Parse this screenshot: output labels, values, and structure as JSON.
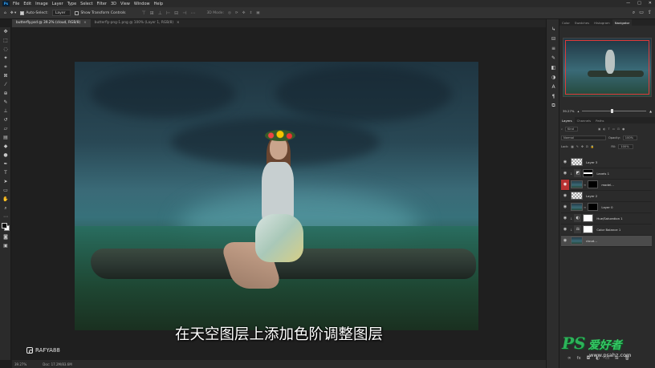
{
  "app": {
    "logo": "Ps"
  },
  "menu": [
    "File",
    "Edit",
    "Image",
    "Layer",
    "Type",
    "Select",
    "Filter",
    "3D",
    "View",
    "Window",
    "Help"
  ],
  "window_controls": [
    "—",
    "□",
    "✕"
  ],
  "options": {
    "auto_select_label": "Auto-Select:",
    "auto_select_target": "Layer",
    "show_transform_label": "Show Transform Controls",
    "mode_3d_label": "3D Mode:"
  },
  "tabs": [
    {
      "label": "butterfly.psd @ 39.2% (cloud, RGB/8)",
      "close": "×"
    },
    {
      "label": "butterfly-png-1.png @ 100% (Layer 1, RGB/8)",
      "close": "×"
    }
  ],
  "subtitle": "在天空图层上添加色阶调整图层",
  "watermark": {
    "handle": "RAFYA88"
  },
  "status": {
    "zoom": "39.27%",
    "doc": "Doc: 17.2M/83.6M"
  },
  "right_panel": {
    "top_tabs": [
      "Color",
      "Swatches",
      "Histogram",
      "Navigator"
    ],
    "active_top_tab": "Navigator",
    "nav_zoom": "39.27%",
    "layer_tabs": [
      "Layers",
      "Channels",
      "Paths"
    ],
    "kind_label": "Kind",
    "blend_mode": "Normal",
    "opacity_label": "Opacity:",
    "opacity_value": "100%",
    "lock_label": "Lock:",
    "fill_label": "Fill:",
    "fill_value": "100%",
    "layers": [
      {
        "name": "Layer 3"
      },
      {
        "name": "Levels 1"
      },
      {
        "name": "model..."
      },
      {
        "name": "Layer 2"
      },
      {
        "name": "Layer 0"
      },
      {
        "name": "Hue/Saturation 1"
      },
      {
        "name": "Color Balance 1"
      },
      {
        "name": "cloud..."
      }
    ]
  },
  "brand_watermark": {
    "logo": "PS",
    "chinese": "爱好者",
    "url": "www.psahz.com"
  }
}
